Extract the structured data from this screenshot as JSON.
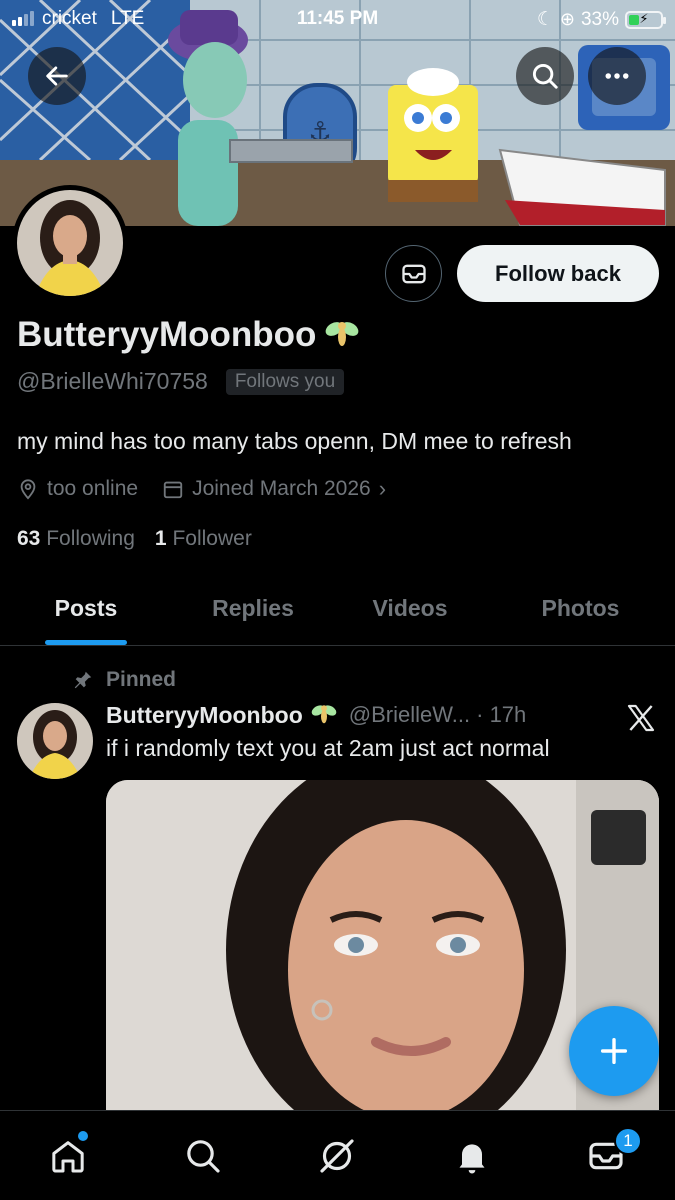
{
  "status_bar": {
    "carrier": "cricket",
    "network": "LTE",
    "time": "11:45 PM",
    "battery": "33%",
    "battery_level": 0.33,
    "battery_color": "#31d158"
  },
  "banner": {
    "back_icon": "arrow-left-icon",
    "search_icon": "search-icon",
    "more_icon": "more-horizontal-icon"
  },
  "profile": {
    "display_name": "ButteryyMoonboo",
    "name_emoji_icon": "fairy-icon",
    "handle": "@BrielleWhi70758",
    "follows_you": "Follows you",
    "bio": "my mind has too many tabs openn, DM mee to refresh",
    "location": "too online",
    "joined": "Joined March 2026",
    "following_count": "63",
    "following_label": "Following",
    "followers_count": "1",
    "followers_label": "Follower",
    "follow_button": "Follow back",
    "message_icon": "message-icon"
  },
  "tabs": [
    {
      "label": "Posts",
      "active": true
    },
    {
      "label": "Replies",
      "active": false
    },
    {
      "label": "Videos",
      "active": false
    },
    {
      "label": "Photos",
      "active": false
    }
  ],
  "post": {
    "pinned_label": "Pinned",
    "author_name": "ButteryyMoonboo",
    "author_handle": "@BrielleW...",
    "time": "· 17h",
    "text": "if i randomly text you at 2am just act normal"
  },
  "bottom_nav": {
    "items": [
      "home-icon",
      "search-icon",
      "grok-icon",
      "notifications-icon",
      "messages-icon"
    ],
    "messages_badge": "1"
  },
  "colors": {
    "accent": "#1d9bf0",
    "background": "#000000",
    "muted_text": "#71767b",
    "primary_text": "#e7e9ea"
  }
}
